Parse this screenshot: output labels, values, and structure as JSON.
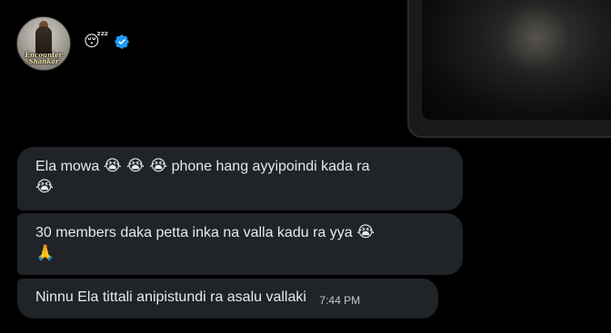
{
  "profile": {
    "avatar_caption_line1": "Encounter",
    "avatar_caption_line2": "Shankar",
    "status_emoji": "😴",
    "verified_icon": "verified-badge-icon",
    "verified_color": "#1d9bf0"
  },
  "media": {
    "icon": "media-thumbnail"
  },
  "messages": [
    {
      "text_before": "Ela mowa",
      "emojis_inline": "😭 😭 😭",
      "text_after": "phone hang ayyipoindi kada ra",
      "trailing_emoji": "😭"
    },
    {
      "text": "30 members daka petta inka na valla kadu ra yya",
      "inline_emoji": "😭",
      "trailing_emoji": "🙏"
    },
    {
      "text": "Ninnu Ela tittali anipistundi ra asalu vallaki",
      "timestamp": "7:44 PM"
    }
  ],
  "colors": {
    "background": "#000000",
    "bubble": "#202327",
    "text": "#e7e9ea"
  }
}
